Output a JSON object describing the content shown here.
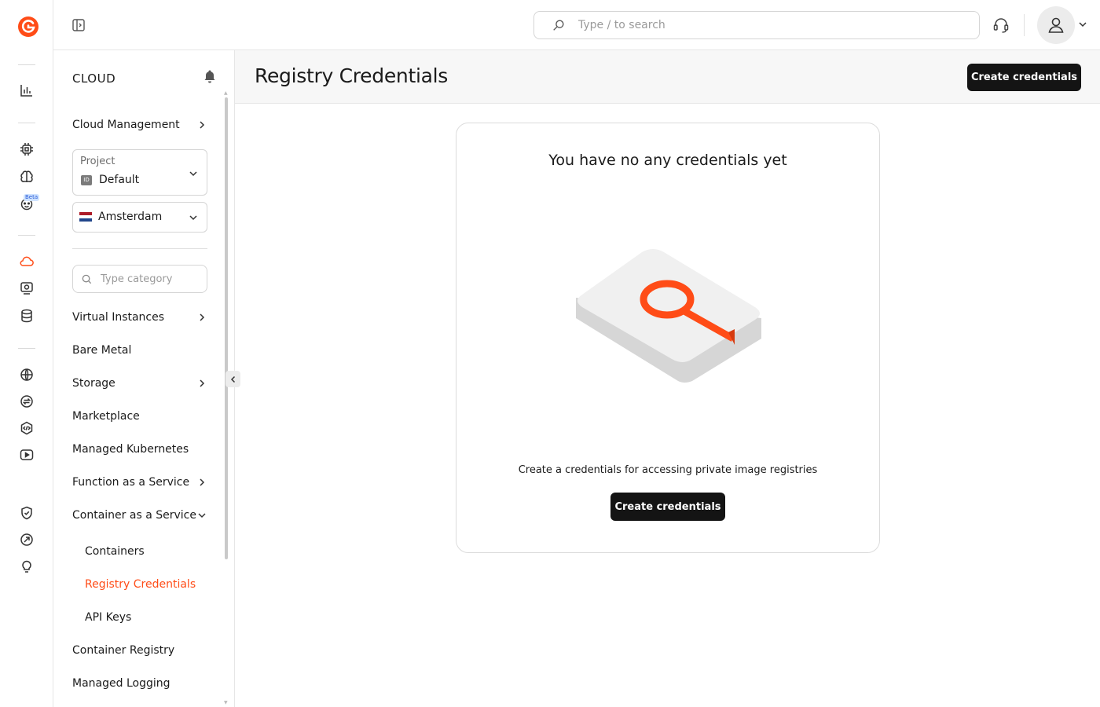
{
  "topbar": {
    "search_placeholder": "Type / to search"
  },
  "rail": {
    "beta_label": "Beta"
  },
  "sidebar": {
    "title": "CLOUD",
    "cloud_management": "Cloud Management",
    "project": {
      "label": "Project",
      "badge": "ID",
      "value": "Default"
    },
    "region": {
      "value": "Amsterdam"
    },
    "category_search_placeholder": "Type category",
    "items": [
      {
        "label": "Virtual Instances",
        "has_chevron": true
      },
      {
        "label": "Bare Metal"
      },
      {
        "label": "Storage",
        "has_chevron": true
      },
      {
        "label": "Marketplace"
      },
      {
        "label": "Managed Kubernetes"
      },
      {
        "label": "Function as a Service",
        "has_chevron": true
      },
      {
        "label": "Container as a Service",
        "expanded": true
      },
      {
        "label": "Containers",
        "sub": true
      },
      {
        "label": "Registry Credentials",
        "sub": true,
        "active": true
      },
      {
        "label": "API Keys",
        "sub": true
      },
      {
        "label": "Container Registry"
      },
      {
        "label": "Managed Logging"
      }
    ]
  },
  "page": {
    "title": "Registry Credentials",
    "create_button": "Create credentials",
    "empty_state": {
      "title": "You have no any credentials yet",
      "description": "Create a credentials for accessing private image registries",
      "button": "Create credentials"
    }
  },
  "colors": {
    "accent": "#ff4c17",
    "dark_button": "#141414"
  }
}
